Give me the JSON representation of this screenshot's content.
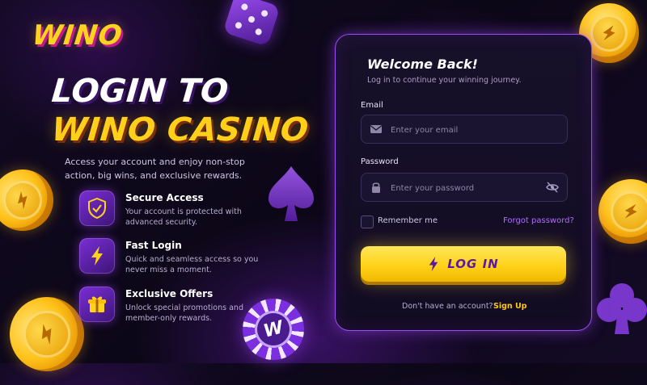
{
  "brand": {
    "logo": "WINO"
  },
  "hero": {
    "line1": "LOGIN TO",
    "line2": "WINO CASINO",
    "lead": "Access your account and enjoy non-stop action, big wins, and exclusive rewards."
  },
  "features": [
    {
      "icon": "shield-check-icon",
      "title": "Secure Access",
      "desc": "Your account is protected with advanced security."
    },
    {
      "icon": "lightning-icon",
      "title": "Fast Login",
      "desc": "Quick and seamless access so you never miss a moment."
    },
    {
      "icon": "gift-icon",
      "title": "Exclusive Offers",
      "desc": "Unlock special promotions and member-only rewards."
    }
  ],
  "login": {
    "title": "Welcome Back!",
    "subtitle": "Log in to continue your winning journey.",
    "email_label": "Email",
    "email_placeholder": "Enter your email",
    "password_label": "Password",
    "password_placeholder": "Enter your password",
    "remember": "Remember me",
    "forgot": "Forgot password?",
    "button": "LOG IN",
    "no_account": "Don't have an account?",
    "signup": "Sign Up"
  },
  "decor": {
    "chip_letter": "W"
  },
  "colors": {
    "accent_yellow": "#ffd21a",
    "accent_purple": "#9a4cf0",
    "background": "#0c0717"
  }
}
